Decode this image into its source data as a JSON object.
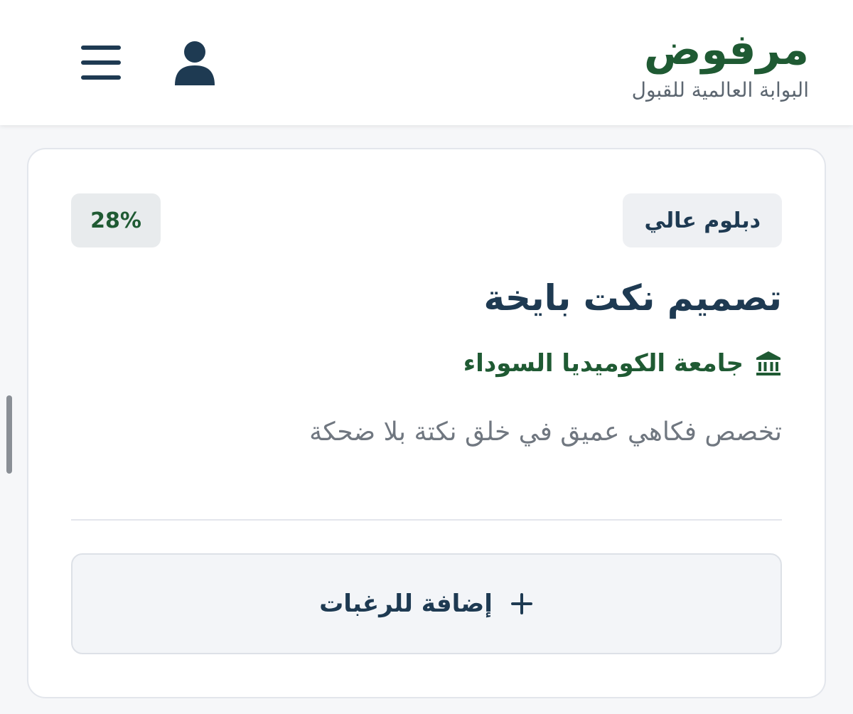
{
  "header": {
    "brand_name": "مرفوض",
    "tagline": "البوابة العالمية للقبول"
  },
  "program": {
    "degree": "دبلوم عالي",
    "match_percent": "28%",
    "title": "تصميم نكت بايخة",
    "university": "جامعة الكوميديا السوداء",
    "description": "تخصص فكاهي عميق في خلق نكتة بلا ضحكة",
    "add_to_wishlist_label": "إضافة للرغبات"
  },
  "icons": {
    "user": "user-icon",
    "menu": "hamburger-menu-icon",
    "university": "university-building-icon",
    "add": "plus-icon"
  },
  "colors": {
    "brand_green": "#1f5a33",
    "navy": "#1e3a52",
    "muted_text": "#707780",
    "badge_bg": "#eef0f3"
  }
}
